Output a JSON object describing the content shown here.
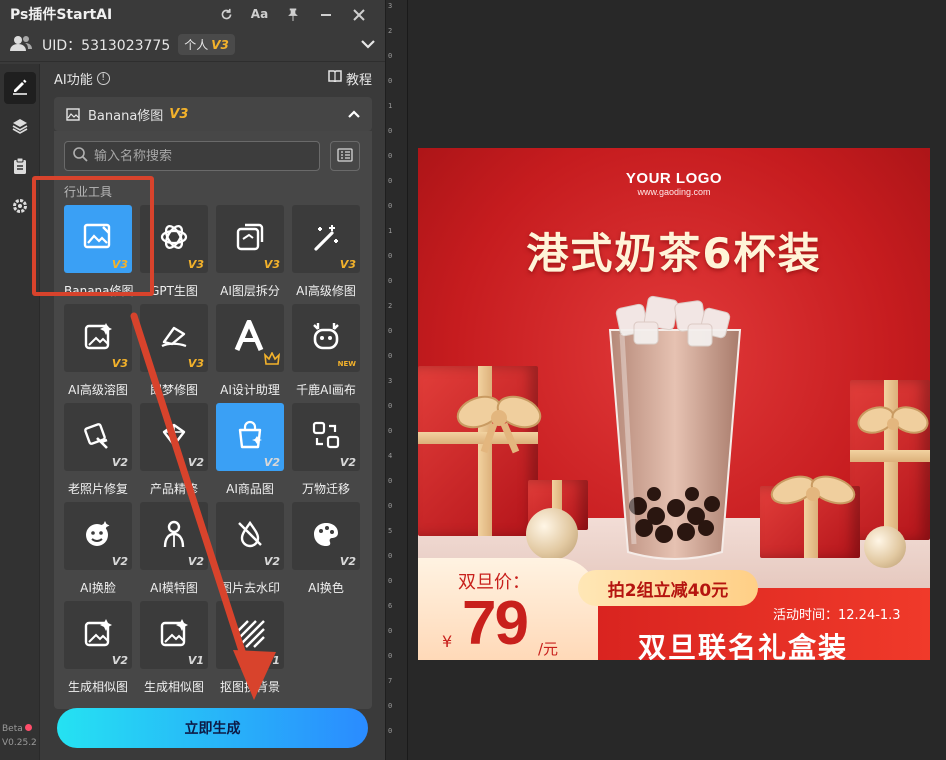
{
  "window": {
    "title": "Ps插件StartAI"
  },
  "titlebar_buttons": [
    {
      "icon": "refresh-icon"
    },
    {
      "icon": "font-size-icon",
      "label": "Aa"
    },
    {
      "icon": "pin-icon"
    },
    {
      "icon": "minimize-icon"
    },
    {
      "icon": "close-icon"
    }
  ],
  "user": {
    "uid_text": "UID：5313023775",
    "plan": "个人",
    "plan_version": "V3"
  },
  "sidebar": {
    "items": [
      {
        "icon": "edit-icon",
        "active": true
      },
      {
        "icon": "layers-icon",
        "active": false
      },
      {
        "icon": "clipboard-icon",
        "active": false
      },
      {
        "icon": "settings-icon",
        "active": false
      }
    ],
    "beta_label": "Beta",
    "version": "V0.25.2"
  },
  "section": {
    "title": "AI功能",
    "info_icon": "info-icon",
    "tutorial_label": "教程"
  },
  "dropdown": {
    "selected": "Banana修图",
    "version": "V3"
  },
  "search": {
    "placeholder": "输入名称搜索"
  },
  "category_label": "行业工具",
  "tools": [
    {
      "label": "Banana修图",
      "version": "V3",
      "selected": true,
      "icon": "image-edit-icon"
    },
    {
      "label": "GPT生图",
      "version": "V3",
      "icon": "chatgpt-icon"
    },
    {
      "label": "AI图层拆分",
      "version": "V3",
      "icon": "layer-split-icon"
    },
    {
      "label": "AI高级修图",
      "version": "V3",
      "icon": "magic-wand-icon"
    },
    {
      "label": "AI高级溶图",
      "version": "V3",
      "icon": "image-sparkle-icon"
    },
    {
      "label": "即梦修图",
      "version": "V3",
      "icon": "dream-icon"
    },
    {
      "label": "AI设计助理",
      "version": "",
      "icon": "ai-letter-icon",
      "crown": true
    },
    {
      "label": "千鹿AI画布",
      "version": "NEW",
      "icon": "deer-icon"
    },
    {
      "label": "老照片修复",
      "version": "V2",
      "icon": "photo-repair-icon"
    },
    {
      "label": "产品精修",
      "version": "V2",
      "icon": "product-retouch-icon"
    },
    {
      "label": "AI商品图",
      "version": "V2",
      "selected": true,
      "icon": "shopping-bag-icon"
    },
    {
      "label": "万物迁移",
      "version": "V2",
      "icon": "transfer-icon"
    },
    {
      "label": "AI换脸",
      "version": "V2",
      "icon": "face-swap-icon"
    },
    {
      "label": "AI模特图",
      "version": "V2",
      "icon": "model-icon"
    },
    {
      "label": "图片去水印",
      "version": "V2",
      "icon": "remove-watermark-icon"
    },
    {
      "label": "AI换色",
      "version": "V2",
      "icon": "palette-icon"
    },
    {
      "label": "生成相似图",
      "version": "V2",
      "icon": "similar-image-icon"
    },
    {
      "label": "生成相似图",
      "version": "V1",
      "icon": "similar-image-icon"
    },
    {
      "label": "抠图换背景",
      "version": "V1",
      "icon": "cutout-background-icon"
    }
  ],
  "generate_button": "立即生成",
  "ruler_ticks": [
    "3",
    "2",
    "0",
    "0",
    "1",
    "0",
    "0",
    "0",
    "0",
    "1",
    "0",
    "0",
    "2",
    "0",
    "0",
    "3",
    "0",
    "0",
    "4",
    "0",
    "0",
    "5",
    "0",
    "0",
    "6",
    "0",
    "0",
    "7",
    "0",
    "0"
  ],
  "ad": {
    "logo": "YOUR LOGO",
    "logo_url": "www.gaoding.com",
    "headline": "港式奶茶6杯装",
    "price_label": "双旦价：",
    "currency": "¥",
    "price": "79",
    "unit": "/元",
    "promo": "拍2组立减40元",
    "period": "活动时间：12.24-1.3",
    "bundle": "双旦联名礼盒装"
  },
  "colors": {
    "accent": "#3aa0f5",
    "version_gold": "#f3b22b",
    "annotation": "#d8432c",
    "ad_red": "#c61c1f"
  }
}
